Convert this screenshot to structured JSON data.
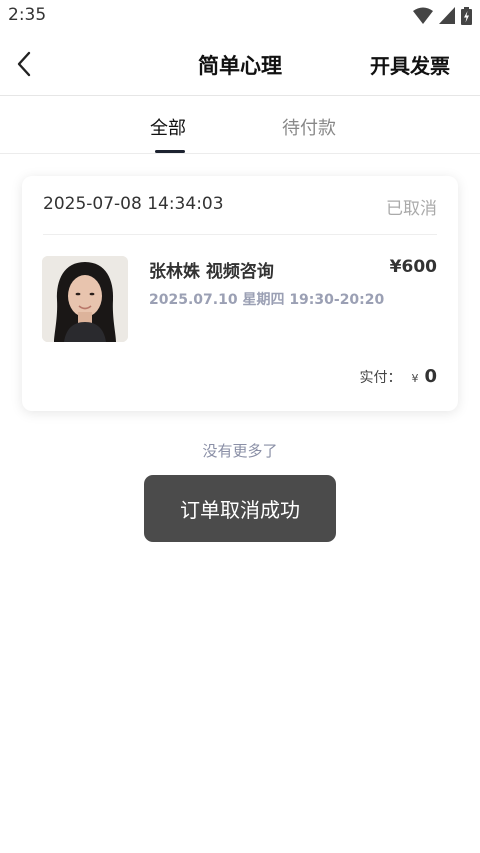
{
  "status_bar": {
    "time": "2:35",
    "icons": [
      "wifi-icon",
      "signal-icon",
      "battery-charging-icon"
    ]
  },
  "nav": {
    "back_icon": "chevron-left-icon",
    "title": "简单心理",
    "invoice_label": "开具发票"
  },
  "tabs": [
    {
      "label": "全部",
      "active": true
    },
    {
      "label": "待付款",
      "active": false
    }
  ],
  "orders": [
    {
      "created_time": "2025-07-08 14:34:03",
      "status": "已取消",
      "consult_title": "张林姝 视频咨询",
      "session_time": "2025.07.10 星期四 19:30-20:20",
      "price": "¥600",
      "paid_label": "实付：",
      "paid_currency": "¥",
      "paid_amount": "0"
    }
  ],
  "list_end_text": "没有更多了",
  "toast_text": "订单取消成功",
  "colors": {
    "accent": "#1c2230",
    "muted": "#9ba0b4",
    "toast_bg": "#3c3c3c"
  }
}
